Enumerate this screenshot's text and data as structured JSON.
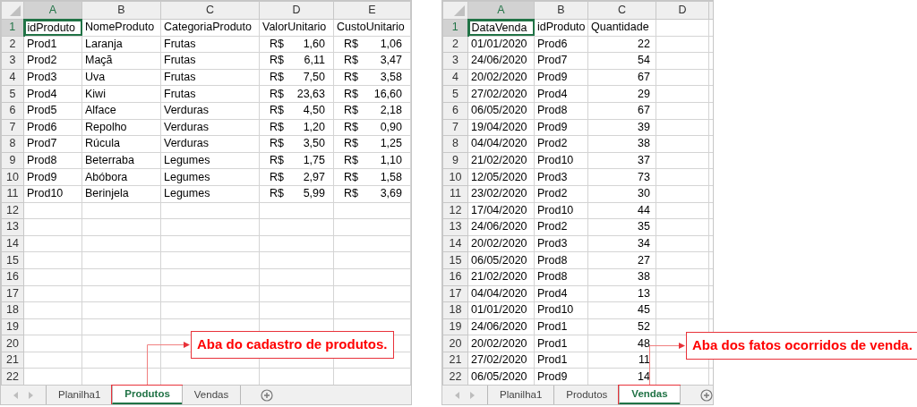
{
  "sheets": [
    {
      "columns": [
        {
          "label": "A",
          "selected": true
        },
        {
          "label": "B",
          "selected": false
        },
        {
          "label": "C",
          "selected": false
        },
        {
          "label": "D",
          "selected": false
        },
        {
          "label": "E",
          "selected": false
        }
      ],
      "rows": [
        {
          "number": "1",
          "selected": true,
          "cells": [
            {
              "kind": "text",
              "value": "idProduto"
            },
            {
              "kind": "text",
              "value": "NomeProduto"
            },
            {
              "kind": "text",
              "value": "CategoriaProduto"
            },
            {
              "kind": "text",
              "value": "ValorUnitario"
            },
            {
              "kind": "text",
              "value": "CustoUnitario"
            }
          ]
        },
        {
          "number": "2",
          "selected": false,
          "cells": [
            {
              "kind": "text",
              "value": "Prod1"
            },
            {
              "kind": "text",
              "value": "Laranja"
            },
            {
              "kind": "text",
              "value": "Frutas"
            },
            {
              "kind": "currency",
              "symbol": "R$",
              "value": "1,60"
            },
            {
              "kind": "currency",
              "symbol": "R$",
              "value": "1,06"
            }
          ]
        },
        {
          "number": "3",
          "selected": false,
          "cells": [
            {
              "kind": "text",
              "value": "Prod2"
            },
            {
              "kind": "text",
              "value": "Maçã"
            },
            {
              "kind": "text",
              "value": "Frutas"
            },
            {
              "kind": "currency",
              "symbol": "R$",
              "value": "6,11"
            },
            {
              "kind": "currency",
              "symbol": "R$",
              "value": "3,47"
            }
          ]
        },
        {
          "number": "4",
          "selected": false,
          "cells": [
            {
              "kind": "text",
              "value": "Prod3"
            },
            {
              "kind": "text",
              "value": "Uva"
            },
            {
              "kind": "text",
              "value": "Frutas"
            },
            {
              "kind": "currency",
              "symbol": "R$",
              "value": "7,50"
            },
            {
              "kind": "currency",
              "symbol": "R$",
              "value": "3,58"
            }
          ]
        },
        {
          "number": "5",
          "selected": false,
          "cells": [
            {
              "kind": "text",
              "value": "Prod4"
            },
            {
              "kind": "text",
              "value": "Kiwi"
            },
            {
              "kind": "text",
              "value": "Frutas"
            },
            {
              "kind": "currency",
              "symbol": "R$",
              "value": "23,63"
            },
            {
              "kind": "currency",
              "symbol": "R$",
              "value": "16,60"
            }
          ]
        },
        {
          "number": "6",
          "selected": false,
          "cells": [
            {
              "kind": "text",
              "value": "Prod5"
            },
            {
              "kind": "text",
              "value": "Alface"
            },
            {
              "kind": "text",
              "value": "Verduras"
            },
            {
              "kind": "currency",
              "symbol": "R$",
              "value": "4,50"
            },
            {
              "kind": "currency",
              "symbol": "R$",
              "value": "2,18"
            }
          ]
        },
        {
          "number": "7",
          "selected": false,
          "cells": [
            {
              "kind": "text",
              "value": "Prod6"
            },
            {
              "kind": "text",
              "value": "Repolho"
            },
            {
              "kind": "text",
              "value": "Verduras"
            },
            {
              "kind": "currency",
              "symbol": "R$",
              "value": "1,20"
            },
            {
              "kind": "currency",
              "symbol": "R$",
              "value": "0,90"
            }
          ]
        },
        {
          "number": "8",
          "selected": false,
          "cells": [
            {
              "kind": "text",
              "value": "Prod7"
            },
            {
              "kind": "text",
              "value": "Rúcula"
            },
            {
              "kind": "text",
              "value": "Verduras"
            },
            {
              "kind": "currency",
              "symbol": "R$",
              "value": "3,50"
            },
            {
              "kind": "currency",
              "symbol": "R$",
              "value": "1,25"
            }
          ]
        },
        {
          "number": "9",
          "selected": false,
          "cells": [
            {
              "kind": "text",
              "value": "Prod8"
            },
            {
              "kind": "text",
              "value": "Beterraba"
            },
            {
              "kind": "text",
              "value": "Legumes"
            },
            {
              "kind": "currency",
              "symbol": "R$",
              "value": "1,75"
            },
            {
              "kind": "currency",
              "symbol": "R$",
              "value": "1,10"
            }
          ]
        },
        {
          "number": "10",
          "selected": false,
          "cells": [
            {
              "kind": "text",
              "value": "Prod9"
            },
            {
              "kind": "text",
              "value": "Abóbora"
            },
            {
              "kind": "text",
              "value": "Legumes"
            },
            {
              "kind": "currency",
              "symbol": "R$",
              "value": "2,97"
            },
            {
              "kind": "currency",
              "symbol": "R$",
              "value": "1,58"
            }
          ]
        },
        {
          "number": "11",
          "selected": false,
          "cells": [
            {
              "kind": "text",
              "value": "Prod10"
            },
            {
              "kind": "text",
              "value": "Berinjela"
            },
            {
              "kind": "text",
              "value": "Legumes"
            },
            {
              "kind": "currency",
              "symbol": "R$",
              "value": "5,99"
            },
            {
              "kind": "currency",
              "symbol": "R$",
              "value": "3,69"
            }
          ]
        },
        {
          "number": "12",
          "selected": false,
          "cells": []
        },
        {
          "number": "13",
          "selected": false,
          "cells": []
        },
        {
          "number": "14",
          "selected": false,
          "cells": []
        },
        {
          "number": "15",
          "selected": false,
          "cells": []
        },
        {
          "number": "16",
          "selected": false,
          "cells": []
        },
        {
          "number": "17",
          "selected": false,
          "cells": []
        },
        {
          "number": "18",
          "selected": false,
          "cells": []
        },
        {
          "number": "19",
          "selected": false,
          "cells": []
        },
        {
          "number": "20",
          "selected": false,
          "cells": []
        },
        {
          "number": "21",
          "selected": false,
          "cells": []
        },
        {
          "number": "22",
          "selected": false,
          "cells": []
        }
      ],
      "tabs": [
        {
          "label": "Planilha1",
          "selected": false
        },
        {
          "label": "Produtos",
          "selected": true
        },
        {
          "label": "Vendas",
          "selected": false
        }
      ],
      "callout": {
        "text": "Aba do cadastro de produtos."
      }
    },
    {
      "columns": [
        {
          "label": "A",
          "selected": true
        },
        {
          "label": "B",
          "selected": false
        },
        {
          "label": "C",
          "selected": false
        },
        {
          "label": "D",
          "selected": false
        }
      ],
      "rows": [
        {
          "number": "1",
          "selected": true,
          "cells": [
            {
              "kind": "text",
              "value": "DataVenda"
            },
            {
              "kind": "text",
              "value": "idProduto"
            },
            {
              "kind": "text",
              "value": "Quantidade"
            }
          ]
        },
        {
          "number": "2",
          "selected": false,
          "cells": [
            {
              "kind": "text",
              "value": "01/01/2020"
            },
            {
              "kind": "text",
              "value": "Prod6"
            },
            {
              "kind": "number",
              "value": "22"
            }
          ]
        },
        {
          "number": "3",
          "selected": false,
          "cells": [
            {
              "kind": "text",
              "value": "24/06/2020"
            },
            {
              "kind": "text",
              "value": "Prod7"
            },
            {
              "kind": "number",
              "value": "54"
            }
          ]
        },
        {
          "number": "4",
          "selected": false,
          "cells": [
            {
              "kind": "text",
              "value": "20/02/2020"
            },
            {
              "kind": "text",
              "value": "Prod9"
            },
            {
              "kind": "number",
              "value": "67"
            }
          ]
        },
        {
          "number": "5",
          "selected": false,
          "cells": [
            {
              "kind": "text",
              "value": "27/02/2020"
            },
            {
              "kind": "text",
              "value": "Prod4"
            },
            {
              "kind": "number",
              "value": "29"
            }
          ]
        },
        {
          "number": "6",
          "selected": false,
          "cells": [
            {
              "kind": "text",
              "value": "06/05/2020"
            },
            {
              "kind": "text",
              "value": "Prod8"
            },
            {
              "kind": "number",
              "value": "67"
            }
          ]
        },
        {
          "number": "7",
          "selected": false,
          "cells": [
            {
              "kind": "text",
              "value": "19/04/2020"
            },
            {
              "kind": "text",
              "value": "Prod9"
            },
            {
              "kind": "number",
              "value": "39"
            }
          ]
        },
        {
          "number": "8",
          "selected": false,
          "cells": [
            {
              "kind": "text",
              "value": "04/04/2020"
            },
            {
              "kind": "text",
              "value": "Prod2"
            },
            {
              "kind": "number",
              "value": "38"
            }
          ]
        },
        {
          "number": "9",
          "selected": false,
          "cells": [
            {
              "kind": "text",
              "value": "21/02/2020"
            },
            {
              "kind": "text",
              "value": "Prod10"
            },
            {
              "kind": "number",
              "value": "37"
            }
          ]
        },
        {
          "number": "10",
          "selected": false,
          "cells": [
            {
              "kind": "text",
              "value": "12/05/2020"
            },
            {
              "kind": "text",
              "value": "Prod3"
            },
            {
              "kind": "number",
              "value": "73"
            }
          ]
        },
        {
          "number": "11",
          "selected": false,
          "cells": [
            {
              "kind": "text",
              "value": "23/02/2020"
            },
            {
              "kind": "text",
              "value": "Prod2"
            },
            {
              "kind": "number",
              "value": "30"
            }
          ]
        },
        {
          "number": "12",
          "selected": false,
          "cells": [
            {
              "kind": "text",
              "value": "17/04/2020"
            },
            {
              "kind": "text",
              "value": "Prod10"
            },
            {
              "kind": "number",
              "value": "44"
            }
          ]
        },
        {
          "number": "13",
          "selected": false,
          "cells": [
            {
              "kind": "text",
              "value": "24/06/2020"
            },
            {
              "kind": "text",
              "value": "Prod2"
            },
            {
              "kind": "number",
              "value": "35"
            }
          ]
        },
        {
          "number": "14",
          "selected": false,
          "cells": [
            {
              "kind": "text",
              "value": "20/02/2020"
            },
            {
              "kind": "text",
              "value": "Prod3"
            },
            {
              "kind": "number",
              "value": "34"
            }
          ]
        },
        {
          "number": "15",
          "selected": false,
          "cells": [
            {
              "kind": "text",
              "value": "06/05/2020"
            },
            {
              "kind": "text",
              "value": "Prod8"
            },
            {
              "kind": "number",
              "value": "27"
            }
          ]
        },
        {
          "number": "16",
          "selected": false,
          "cells": [
            {
              "kind": "text",
              "value": "21/02/2020"
            },
            {
              "kind": "text",
              "value": "Prod8"
            },
            {
              "kind": "number",
              "value": "38"
            }
          ]
        },
        {
          "number": "17",
          "selected": false,
          "cells": [
            {
              "kind": "text",
              "value": "04/04/2020"
            },
            {
              "kind": "text",
              "value": "Prod4"
            },
            {
              "kind": "number",
              "value": "13"
            }
          ]
        },
        {
          "number": "18",
          "selected": false,
          "cells": [
            {
              "kind": "text",
              "value": "01/01/2020"
            },
            {
              "kind": "text",
              "value": "Prod10"
            },
            {
              "kind": "number",
              "value": "45"
            }
          ]
        },
        {
          "number": "19",
          "selected": false,
          "cells": [
            {
              "kind": "text",
              "value": "24/06/2020"
            },
            {
              "kind": "text",
              "value": "Prod1"
            },
            {
              "kind": "number",
              "value": "52"
            }
          ]
        },
        {
          "number": "20",
          "selected": false,
          "cells": [
            {
              "kind": "text",
              "value": "20/02/2020"
            },
            {
              "kind": "text",
              "value": "Prod1"
            },
            {
              "kind": "number",
              "value": "48"
            }
          ]
        },
        {
          "number": "21",
          "selected": false,
          "cells": [
            {
              "kind": "text",
              "value": "27/02/2020"
            },
            {
              "kind": "text",
              "value": "Prod1"
            },
            {
              "kind": "number",
              "value": "11"
            }
          ]
        },
        {
          "number": "22",
          "selected": false,
          "cells": [
            {
              "kind": "text",
              "value": "06/05/2020"
            },
            {
              "kind": "text",
              "value": "Prod9"
            },
            {
              "kind": "number",
              "value": "14"
            }
          ]
        }
      ],
      "tabs": [
        {
          "label": "Planilha1",
          "selected": false
        },
        {
          "label": "Produtos",
          "selected": false
        },
        {
          "label": "Vendas",
          "selected": true
        }
      ],
      "callout": {
        "text": "Aba dos fatos ocorridos de venda."
      }
    }
  ]
}
